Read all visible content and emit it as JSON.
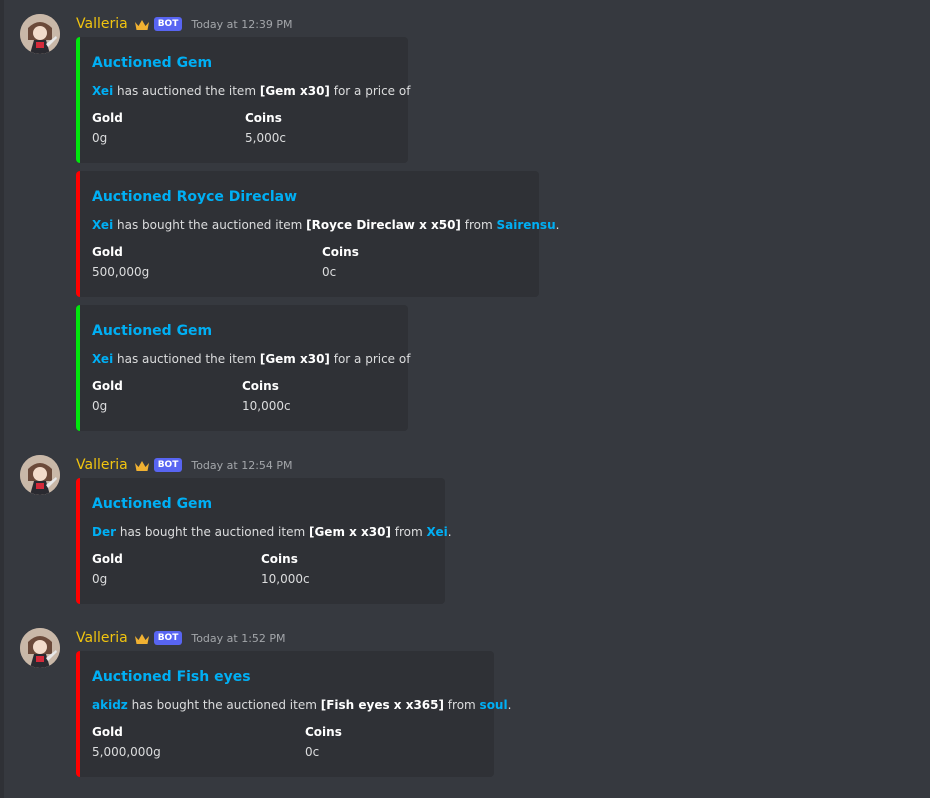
{
  "groups": [
    {
      "username": "Valleria",
      "bot_tag": "BOT",
      "timestamp": "Today at 12:39 PM",
      "embeds": [
        {
          "color": "#00e70c",
          "title": "Auctioned Gem",
          "desc": {
            "user": "Xei",
            "text1": " has auctioned the item ",
            "item": "[Gem x30]",
            "text2": " for a price of",
            "from_user": "",
            "end": ""
          },
          "fields": [
            {
              "name": "Gold",
              "value": "0g"
            },
            {
              "name": "Coins",
              "value": "5,000c"
            }
          ]
        },
        {
          "color": "#ff0000",
          "title": "Auctioned Royce Direclaw",
          "desc": {
            "user": "Xei",
            "text1": " has bought the auctioned item ",
            "item": "[Royce Direclaw x x50]",
            "text2": " from ",
            "from_user": "Sairensu",
            "end": "."
          },
          "fields": [
            {
              "name": "Gold",
              "value": "500,000g"
            },
            {
              "name": "Coins",
              "value": "0c"
            }
          ]
        },
        {
          "color": "#00e70c",
          "title": "Auctioned Gem",
          "desc": {
            "user": "Xei",
            "text1": " has auctioned the item ",
            "item": "[Gem x30]",
            "text2": " for a price of",
            "from_user": "",
            "end": ""
          },
          "fields": [
            {
              "name": "Gold",
              "value": "0g"
            },
            {
              "name": "Coins",
              "value": "10,000c"
            }
          ]
        }
      ]
    },
    {
      "username": "Valleria",
      "bot_tag": "BOT",
      "timestamp": "Today at 12:54 PM",
      "embeds": [
        {
          "color": "#ff0000",
          "title": "Auctioned Gem",
          "desc": {
            "user": "Der",
            "text1": " has bought the auctioned item ",
            "item": "[Gem x x30]",
            "text2": " from ",
            "from_user": "Xei",
            "end": "."
          },
          "fields": [
            {
              "name": "Gold",
              "value": "0g"
            },
            {
              "name": "Coins",
              "value": "10,000c"
            }
          ]
        }
      ]
    },
    {
      "username": "Valleria",
      "bot_tag": "BOT",
      "timestamp": "Today at 1:52 PM",
      "embeds": [
        {
          "color": "#ff0000",
          "title": "Auctioned Fish eyes",
          "desc": {
            "user": "akidz",
            "text1": " has bought the auctioned item ",
            "item": "[Fish eyes x x365]",
            "text2": " from ",
            "from_user": "soul",
            "end": "."
          },
          "fields": [
            {
              "name": "Gold",
              "value": "5,000,000g"
            },
            {
              "name": "Coins",
              "value": "0c"
            }
          ]
        }
      ]
    }
  ],
  "icons": {
    "crown": "crown-icon",
    "avatar": "avatar"
  }
}
